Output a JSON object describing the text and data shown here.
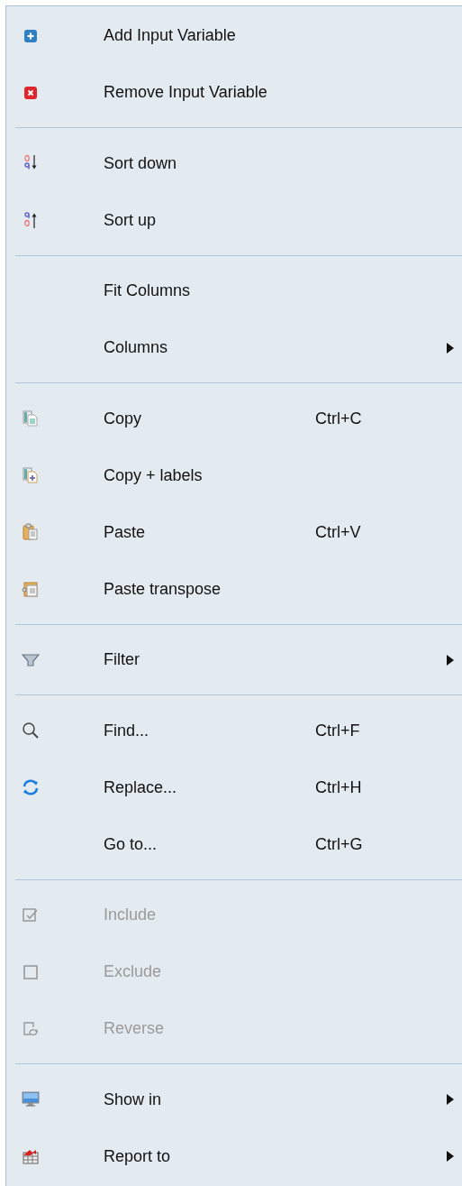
{
  "menu": {
    "sections": [
      {
        "items": [
          {
            "label": "Add Input Variable",
            "disabled": false,
            "submenu": false
          },
          {
            "label": "Remove Input Variable",
            "disabled": false,
            "submenu": false
          }
        ]
      },
      {
        "items": [
          {
            "label": "Sort down",
            "disabled": false,
            "submenu": false
          },
          {
            "label": "Sort up",
            "disabled": false,
            "submenu": false
          }
        ]
      },
      {
        "items": [
          {
            "label": "Fit Columns",
            "disabled": false,
            "submenu": false
          },
          {
            "label": "Columns",
            "disabled": false,
            "submenu": true
          }
        ]
      },
      {
        "items": [
          {
            "label": "Copy",
            "shortcut": "Ctrl+C",
            "disabled": false,
            "submenu": false
          },
          {
            "label": "Copy + labels",
            "disabled": false,
            "submenu": false
          },
          {
            "label": "Paste",
            "shortcut": "Ctrl+V",
            "disabled": false,
            "submenu": false
          },
          {
            "label": "Paste transpose",
            "disabled": false,
            "submenu": false
          }
        ]
      },
      {
        "items": [
          {
            "label": "Filter",
            "disabled": false,
            "submenu": true
          }
        ]
      },
      {
        "items": [
          {
            "label": "Find...",
            "shortcut": "Ctrl+F",
            "disabled": false,
            "submenu": false
          },
          {
            "label": "Replace...",
            "shortcut": "Ctrl+H",
            "disabled": false,
            "submenu": false
          },
          {
            "label": "Go to...",
            "shortcut": "Ctrl+G",
            "disabled": false,
            "submenu": false
          }
        ]
      },
      {
        "items": [
          {
            "label": "Include",
            "disabled": true,
            "submenu": false
          },
          {
            "label": "Exclude",
            "disabled": true,
            "submenu": false
          },
          {
            "label": "Reverse",
            "disabled": true,
            "submenu": false
          }
        ]
      },
      {
        "items": [
          {
            "label": "Show in",
            "disabled": false,
            "submenu": true
          },
          {
            "label": "Report to",
            "disabled": false,
            "submenu": true
          }
        ]
      }
    ]
  }
}
